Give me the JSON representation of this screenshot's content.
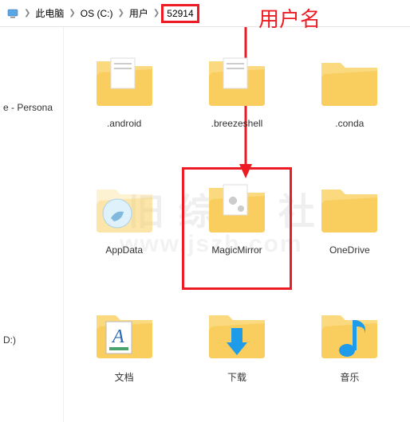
{
  "breadcrumb": {
    "items": [
      "此电脑",
      "OS (C:)",
      "用户",
      "52914"
    ]
  },
  "annotation": "用户名",
  "sidebar": {
    "persona": "e - Persona",
    "driveD": "D:)"
  },
  "folders": [
    {
      "label": ".android"
    },
    {
      "label": ".breezeshell"
    },
    {
      "label": ".conda"
    },
    {
      "label": "AppData"
    },
    {
      "label": "MagicMirror"
    },
    {
      "label": "OneDrive"
    },
    {
      "label": "文档"
    },
    {
      "label": "下载"
    },
    {
      "label": "音乐"
    }
  ],
  "watermark": {
    "line1": "旧 综 合 社 区",
    "line2": "www.jszh.com"
  }
}
